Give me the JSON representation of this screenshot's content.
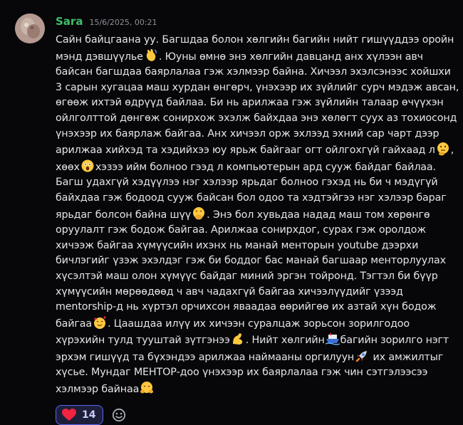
{
  "message": {
    "author": "Sara",
    "timestamp": "15/6/2025, 00:21",
    "lines": [
      [
        "Сайн байцгаана уу. Багшдаа болон хөлгийн багийн нийт гишүүддээ оройн"
      ],
      [
        "мэнд дэвшүүлье",
        "wave-emoji",
        ". Юуны өмнө энэ хөлгийн давцанд анх хүлээн авч"
      ],
      [
        "байсан багшдаа баярлалаа гэж хэлмээр байна. Хичээл эхэлсэнээс хойшхи"
      ],
      [
        "3 сарын хугацаа маш хурдан өнгөрч, үнэхээр их зүйлийг сурч мэдэж авсан,"
      ],
      [
        "өгөөж ихтэй өдрүүд байлаа. Би нь арилжаа гэж зүйлийн талаар өчүүхэн"
      ],
      [
        "ойлголттой дөнгөж сонирхож эхэлж байхдаа энэ хөлөгт суух аз тохиосонд"
      ],
      [
        "үнэхээр их баярлаж байгаа. Анх хичээл орж эхлээд эхний сар чарт дээр"
      ],
      [
        "арилжаа хийхэд та хэдийхээ юу ярьж байгааг огт ойлгохгүй гайхаад л",
        "thinking-emoji",
        ","
      ],
      [
        "хөөх",
        "astonished-emoji",
        "хэзээ ийм болноо гээд л компьютерын ард сууж байдаг байлаа."
      ],
      [
        "Багш удахгүй хэдүүлээ нэг хэлээр ярьдаг болноо гэхэд нь би ч мэдүгүй"
      ],
      [
        "байхдаа гэж бодоод сууж байсан бол одоо та хэдтэйгээ нэг хэлээр бараг"
      ],
      [
        "ярьдаг болсон байна шүү",
        "hand-over-mouth-emoji",
        ". Энэ бол хувьдаа надад маш том хөрөнгө"
      ],
      [
        "оруулалт гэж бодож байгаа. Арилжаа сонирхдог, сурах гэж оролдож"
      ],
      [
        "хичээж байгаа хүмүүсийн ихэнх нь манай менторын youtube дээрхи"
      ],
      [
        "бичлэгийг үзэж эхэлдэг гэж би боддог бас манай багшаар менторлуулах"
      ],
      [
        "хүсэлтэй маш олон хүмүүс байдаг миний эргэн тойронд. Тэгтэл би бүүр"
      ],
      [
        "хүмүүсийн мөрөөдөөд ч авч чадахгүй байгаа хичээлүүдийг үзээд"
      ],
      [
        "mentorship-д нь хүртэл орчихсон яваадаа өөрийгөө их азтай хүн бодож"
      ],
      [
        "байгаа",
        "smiling-hearts-emoji",
        ". Цаашдаа илүү их хичээн суралцаж зорьсон зорилгодоо"
      ],
      [
        "хүрэхийн тулд тууштай зүтгэнээ",
        "flexed-biceps-emoji",
        ". Нийт хөлгийн",
        "ship-emoji",
        "багийн зорилго нэгт"
      ],
      [
        "эрхэм гишүүд та бүхэндээ арилжаа наймааны оргилуун",
        "rocket-emoji",
        " их амжилтыг"
      ],
      [
        "хүсье. Мундаг МЕНТОР-доо үнэхээр их баярлалаа гэж чин сэтгэлээсээ"
      ],
      [
        "хэлмээр байнаа",
        "hugging-emoji"
      ]
    ]
  },
  "reactions": [
    {
      "emoji": "heart-emoji",
      "count": "14",
      "selected": true
    }
  ],
  "add_reaction": {
    "icon": "add-reaction-icon"
  },
  "colors": {
    "background": "#070709",
    "author": "#3fbf6a",
    "timestamp": "#8b8f98",
    "text": "#e3e5e8",
    "reaction_border": "#5865f2",
    "reaction_bg": "#1d1f3a"
  }
}
